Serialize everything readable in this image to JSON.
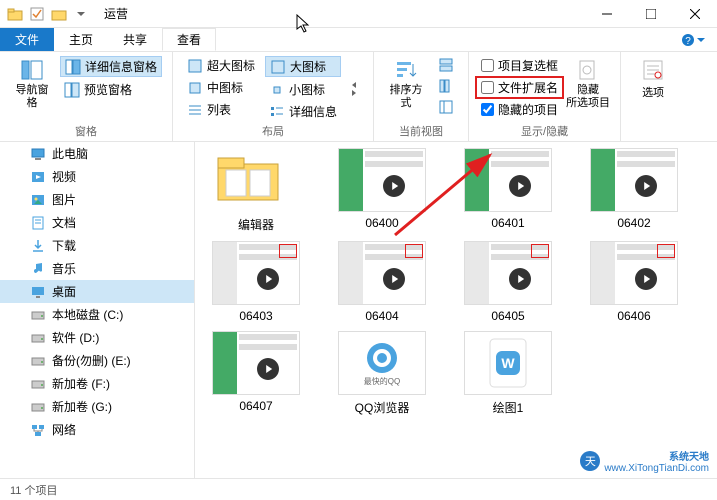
{
  "window": {
    "title": "运营"
  },
  "tabs": {
    "file": "文件",
    "home": "主页",
    "share": "共享",
    "view": "查看"
  },
  "ribbon": {
    "panes": {
      "label": "窗格",
      "nav": "导航窗格",
      "preview": "预览窗格",
      "details": "详细信息窗格"
    },
    "layout": {
      "label": "布局",
      "extra_large": "超大图标",
      "large": "大图标",
      "medium": "中图标",
      "small": "小图标",
      "list": "列表",
      "details": "详细信息"
    },
    "current_view": {
      "label": "当前视图",
      "sort": "排序方式"
    },
    "show_hide": {
      "label": "显示/隐藏",
      "checkboxes": "项目复选框",
      "extensions": "文件扩展名",
      "hidden_items": "隐藏的项目",
      "hide_selected": "隐藏\n所选项目"
    },
    "options": "选项"
  },
  "tree": [
    {
      "label": "此电脑",
      "icon": "pc"
    },
    {
      "label": "视频",
      "icon": "video"
    },
    {
      "label": "图片",
      "icon": "picture"
    },
    {
      "label": "文档",
      "icon": "document"
    },
    {
      "label": "下载",
      "icon": "download"
    },
    {
      "label": "音乐",
      "icon": "music"
    },
    {
      "label": "桌面",
      "icon": "desktop",
      "selected": true
    },
    {
      "label": "本地磁盘 (C:)",
      "icon": "drive"
    },
    {
      "label": "软件 (D:)",
      "icon": "drive"
    },
    {
      "label": "备份(勿删) (E:)",
      "icon": "drive"
    },
    {
      "label": "新加卷 (F:)",
      "icon": "drive"
    },
    {
      "label": "新加卷 (G:)",
      "icon": "drive"
    },
    {
      "label": "网络",
      "icon": "network"
    }
  ],
  "files": [
    {
      "label": "编辑器",
      "type": "folder"
    },
    {
      "label": "06400",
      "type": "image"
    },
    {
      "label": "06401",
      "type": "image"
    },
    {
      "label": "06402",
      "type": "image"
    },
    {
      "label": "06403",
      "type": "image-hl"
    },
    {
      "label": "06404",
      "type": "image-hl"
    },
    {
      "label": "06405",
      "type": "image-hl"
    },
    {
      "label": "06406",
      "type": "image-hl"
    },
    {
      "label": "06407",
      "type": "image"
    },
    {
      "label": "QQ浏览器",
      "type": "qq"
    },
    {
      "label": "绘图1",
      "type": "docx"
    }
  ],
  "status": {
    "count": "11 个项目"
  },
  "watermark": {
    "brand": "系统天地",
    "url": "www.XiTongTianDi.com"
  }
}
